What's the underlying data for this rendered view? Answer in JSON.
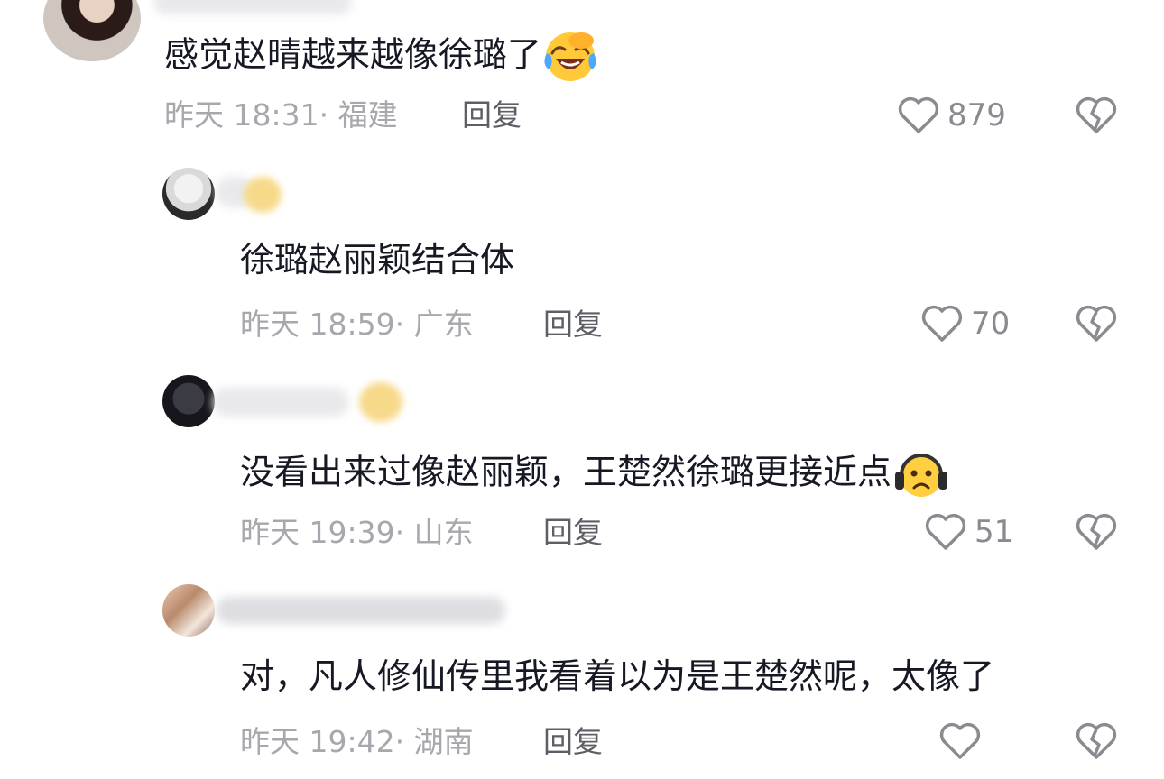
{
  "comments": [
    {
      "text": "感觉赵晴越来越像徐璐了",
      "time": "昨天 18:31·",
      "region": "福建",
      "reply_label": "回复",
      "likes": "879",
      "emoji": "face-with-tears-of-joy-icon"
    },
    {
      "text": "徐璐赵丽颖结合体",
      "time": "昨天 18:59·",
      "region": "广东",
      "reply_label": "回复",
      "likes": "70"
    },
    {
      "text": "没看出来过像赵丽颖，王楚然徐璐更接近点",
      "time": "昨天 19:39·",
      "region": "山东",
      "reply_label": "回复",
      "likes": "51",
      "emoji": "frowning-face-headphones-icon"
    },
    {
      "text": "对，凡人修仙传里我看着以为是王楚然呢，太像了",
      "time": "昨天 19:42·",
      "region": "湖南",
      "reply_label": "回复"
    }
  ],
  "colors": {
    "text": "#161823",
    "meta": "#a7a8ad",
    "reply": "#5e5f66",
    "icon": "#8a8b91"
  },
  "icons": [
    "heart-outline-icon",
    "broken-heart-icon"
  ]
}
